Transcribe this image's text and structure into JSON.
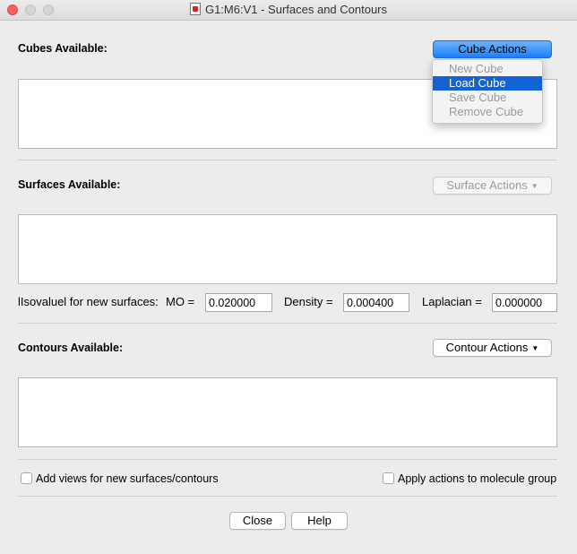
{
  "window": {
    "title": "G1:M6:V1 - Surfaces and Contours"
  },
  "cubes": {
    "label": "Cubes Available:",
    "actions_button": "Cube Actions",
    "menu": [
      {
        "label": "New Cube",
        "enabled": false,
        "highlighted": false
      },
      {
        "label": "Load Cube",
        "enabled": true,
        "highlighted": true
      },
      {
        "label": "Save Cube",
        "enabled": false,
        "highlighted": false
      },
      {
        "label": "Remove Cube",
        "enabled": false,
        "highlighted": false
      }
    ]
  },
  "surfaces": {
    "label": "Surfaces Available:",
    "actions_button": "Surface Actions",
    "isovalue_label": "lIsovaluel for new surfaces:",
    "mo_label": "MO =",
    "mo_value": "0.020000",
    "density_label": "Density =",
    "density_value": "0.000400",
    "laplacian_label": "Laplacian =",
    "laplacian_value": "0.000000"
  },
  "contours": {
    "label": "Contours Available:",
    "actions_button": "Contour Actions"
  },
  "options": {
    "add_views_label": "Add views for new surfaces/contours",
    "add_views_checked": false,
    "apply_group_label": "Apply actions to molecule group",
    "apply_group_checked": false
  },
  "footer": {
    "close_label": "Close",
    "help_label": "Help"
  },
  "colors": {
    "accent": "#1a82fb",
    "menu_highlight": "#1463d6",
    "background": "#ececec"
  }
}
